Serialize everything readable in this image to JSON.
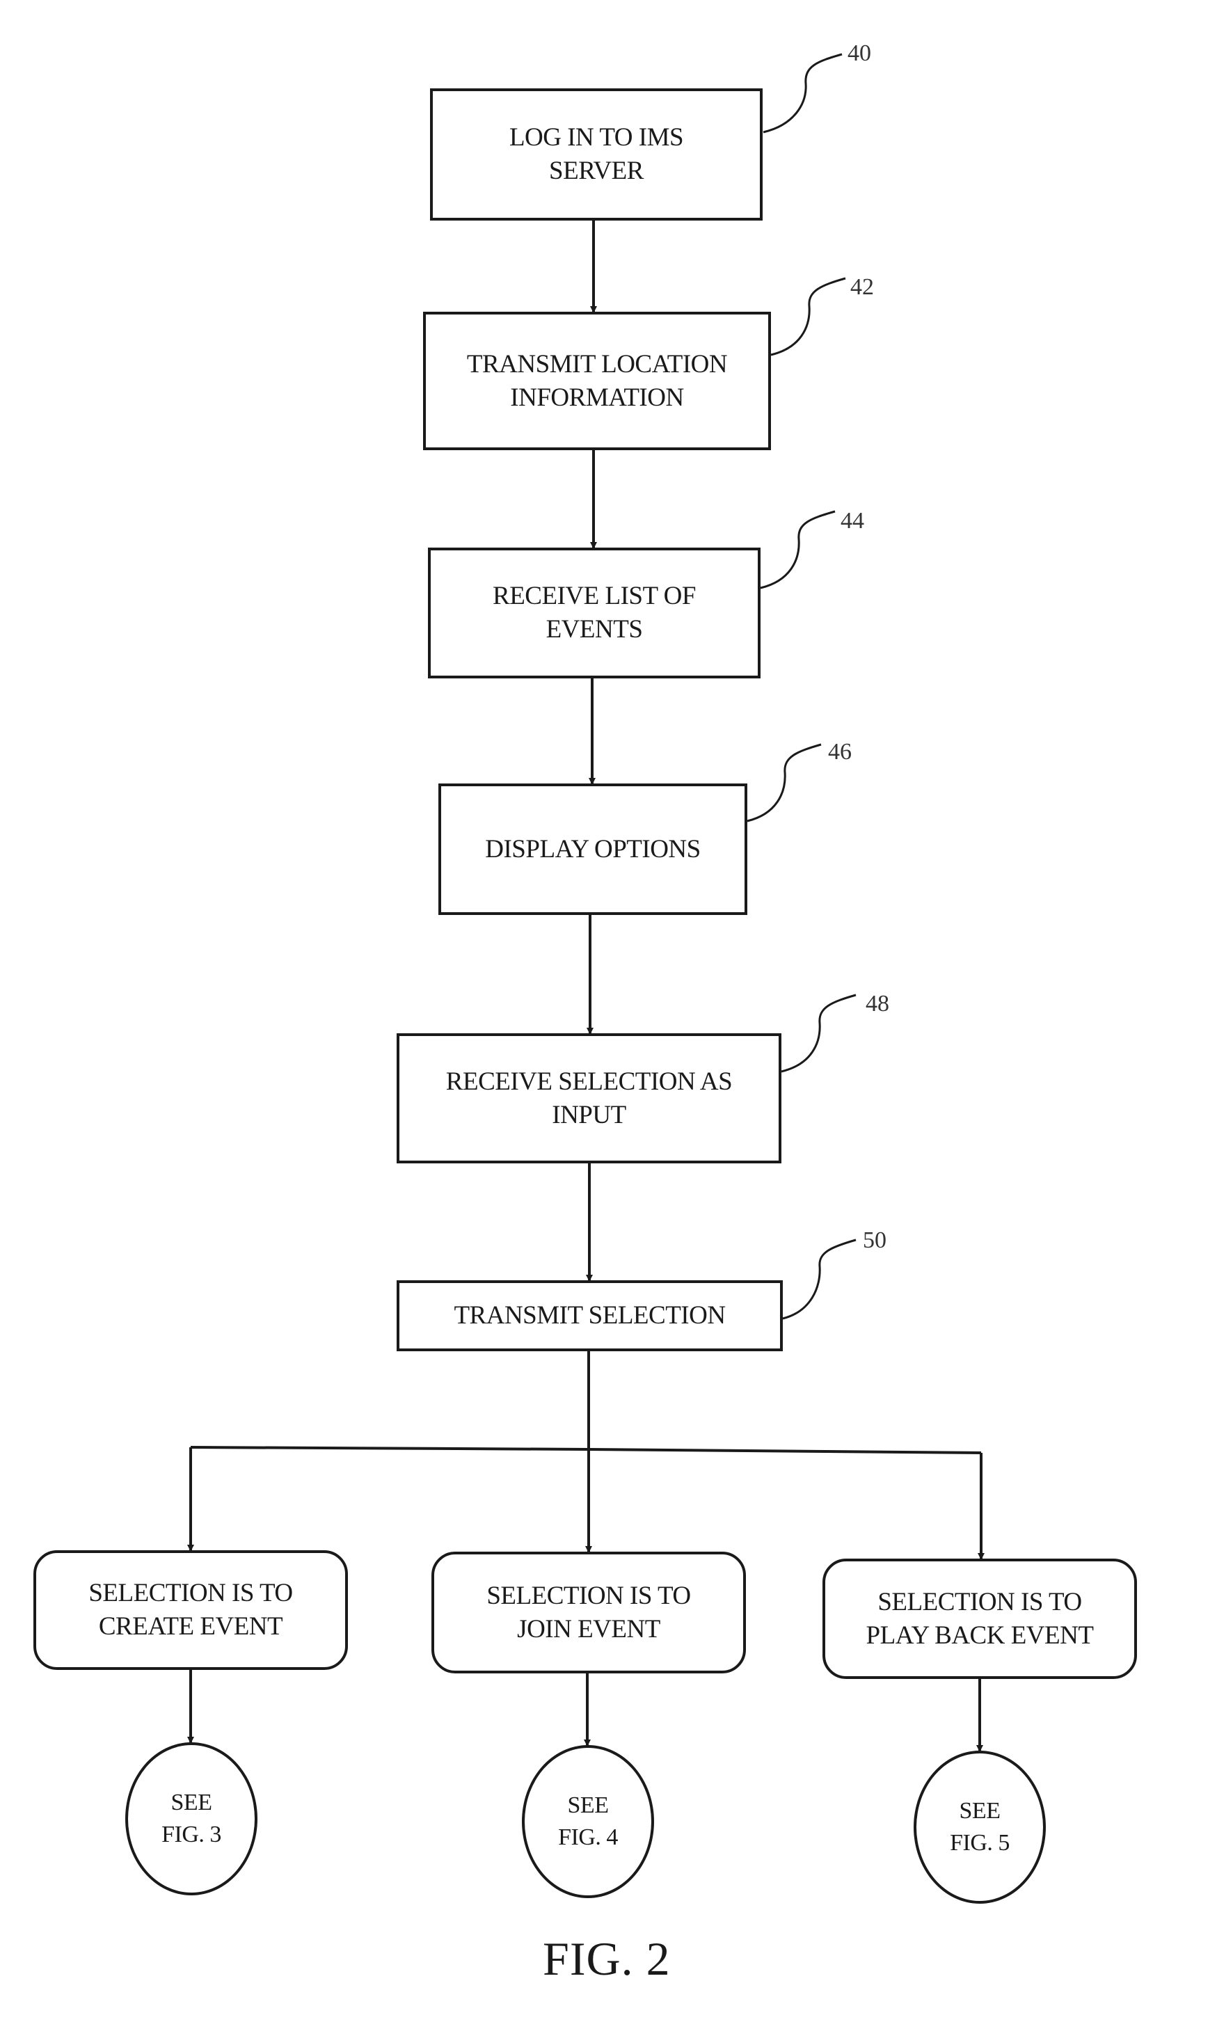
{
  "figure": {
    "title": "FIG. 2",
    "steps": [
      {
        "id": "step-40",
        "ref": "40",
        "text": "LOG IN TO IMS\nSERVER",
        "shape": "rectangle"
      },
      {
        "id": "step-42",
        "ref": "42",
        "text": "TRANSMIT LOCATION\nINFORMATION",
        "shape": "rectangle"
      },
      {
        "id": "step-44",
        "ref": "44",
        "text": "RECEIVE LIST OF\nEVENTS",
        "shape": "rectangle"
      },
      {
        "id": "step-46",
        "ref": "46",
        "text": "DISPLAY OPTIONS",
        "shape": "rectangle"
      },
      {
        "id": "step-48",
        "ref": "48",
        "text": "RECEIVE SELECTION AS\nINPUT",
        "shape": "rectangle"
      },
      {
        "id": "step-50",
        "ref": "50",
        "text": "TRANSMIT SELECTION",
        "shape": "rectangle"
      }
    ],
    "branches": [
      {
        "id": "create",
        "text": "SELECTION IS TO\nCREATE EVENT",
        "shape": "rounded-rectangle",
        "connector": "SEE\nFIG. 3"
      },
      {
        "id": "join",
        "text": "SELECTION IS TO\nJOIN EVENT",
        "shape": "rounded-rectangle",
        "connector": "SEE\nFIG. 4"
      },
      {
        "id": "playback",
        "text": "SELECTION IS TO\nPLAY BACK EVENT",
        "shape": "rounded-rectangle",
        "connector": "SEE\nFIG. 5"
      }
    ],
    "edges": [
      [
        "step-40",
        "step-42"
      ],
      [
        "step-42",
        "step-44"
      ],
      [
        "step-44",
        "step-46"
      ],
      [
        "step-46",
        "step-48"
      ],
      [
        "step-48",
        "step-50"
      ],
      [
        "step-50",
        "create"
      ],
      [
        "step-50",
        "join"
      ],
      [
        "step-50",
        "playback"
      ],
      [
        "create",
        "see-fig-3"
      ],
      [
        "join",
        "see-fig-4"
      ],
      [
        "playback",
        "see-fig-5"
      ]
    ]
  }
}
